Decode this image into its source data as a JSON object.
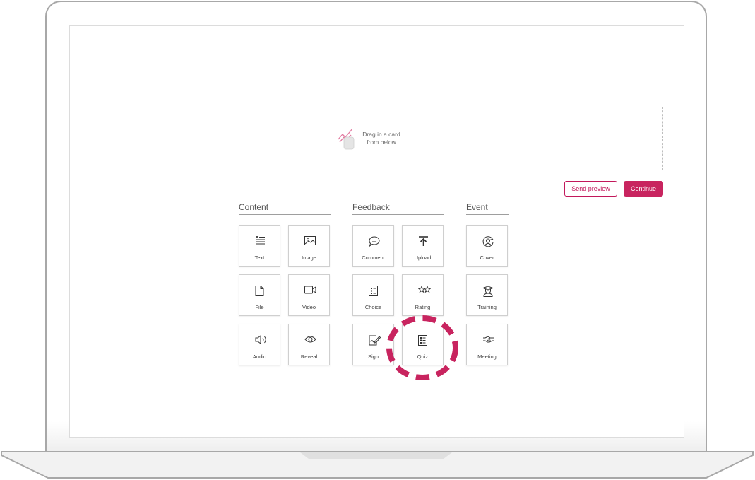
{
  "dropzone": {
    "line1": "Drag in a card",
    "line2": "from below"
  },
  "actions": {
    "send_preview": "Send preview",
    "continue": "Continue"
  },
  "sections": {
    "content": {
      "title": "Content",
      "cards": {
        "text": "Text",
        "image": "Image",
        "file": "File",
        "video": "Video",
        "audio": "Audio",
        "reveal": "Reveal"
      }
    },
    "feedback": {
      "title": "Feedback",
      "cards": {
        "comment": "Comment",
        "upload": "Upload",
        "choice": "Choice",
        "rating": "Rating",
        "sign": "Sign",
        "quiz": "Quiz"
      }
    },
    "event": {
      "title": "Event",
      "cards": {
        "cover": "Cover",
        "training": "Training",
        "meeting": "Meeting"
      }
    }
  },
  "highlighted_card": "Quiz",
  "colors": {
    "accent": "#c8245f",
    "highlight_ring": "#c8245f",
    "border": "#cfcfcf"
  }
}
